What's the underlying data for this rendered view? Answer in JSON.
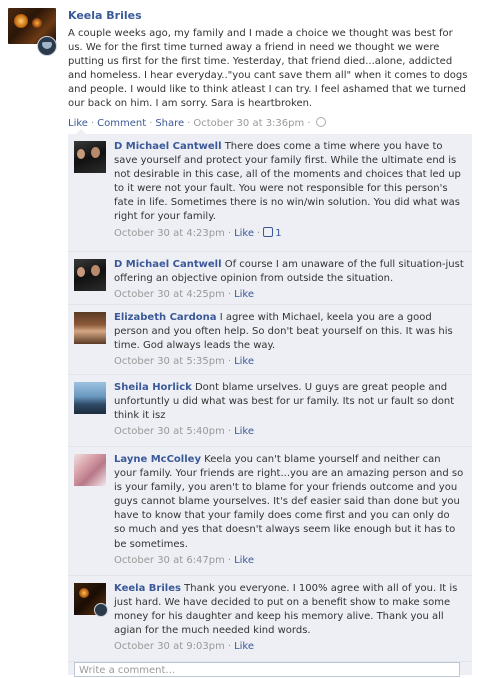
{
  "post": {
    "author": "Keela Briles",
    "text": "A couple weeks ago, my family and I made a choice we thought was best for us. We for the first time turned away a friend in need we thought we were putting us first for the first time. Yesterday, that friend died...alone, addicted and homeless. I hear everyday..\"you cant save them all\" when it comes to dogs and people. I would like to think atleast I can try. I feel ashamed that we turned our back on him. I am sorry. Sara is heartbroken.",
    "actions": {
      "like": "Like",
      "comment": "Comment",
      "share": "Share",
      "time": "October 30 at 3:36pm"
    },
    "globe_icon": "globe-icon"
  },
  "comments": [
    {
      "author": "D Michael Cantwell",
      "text": "There does come a time where you have to save yourself and protect your family first. While the ultimate end is not desirable in this case, all of the moments and choices that led up to it were not your fault. You were not responsible for this person's fate in life. Sometimes there is no win/win solution. You did what was right for your family.",
      "time": "October 30 at 4:23pm",
      "like": "Like",
      "like_count": "1"
    },
    {
      "author": "D Michael Cantwell",
      "text": "Of course I am unaware of the full situation-just offering an objective opinion from outside the situation.",
      "time": "October 30 at 4:25pm",
      "like": "Like"
    },
    {
      "author": "Elizabeth Cardona",
      "text": "I agree with Michael, keela you are a good person and you often help. So don't beat yourself on this. It was his time. God always leads the way.",
      "time": "October 30 at 5:35pm",
      "like": "Like"
    },
    {
      "author": "Sheila Horlick",
      "text": "Dont blame urselves. U guys are great people and unfortuntly u did what was best for ur family. Its not ur fault so dont think it isz",
      "time": "October 30 at 5:40pm",
      "like": "Like"
    },
    {
      "author": "Layne McColley",
      "text": "Keela you can't blame yourself and neither can your family. Your friends are right...you are an amazing person and so is your family, you aren't to blame for your friends outcome and you guys cannot blame yourselves. It's def easier said than done but you have to know that your family does come first and you can only do so much and yes that doesn't always seem like enough but it has to be sometimes.",
      "time": "October 30 at 6:47pm",
      "like": "Like"
    },
    {
      "author": "Keela Briles",
      "text": "Thank you everyone. I 100% agree with all of you. It is just hard. We have decided to put on a benefit show to make some money for his daughter and keep his memory alive. Thank you all agian for the much needed kind words.",
      "time": "October 30 at 9:03pm",
      "like": "Like"
    }
  ],
  "write_comment": {
    "placeholder": "Write a comment..."
  },
  "colors": {
    "link": "#3b5998",
    "comment_bg": "#edeff4",
    "meta": "#999999"
  }
}
